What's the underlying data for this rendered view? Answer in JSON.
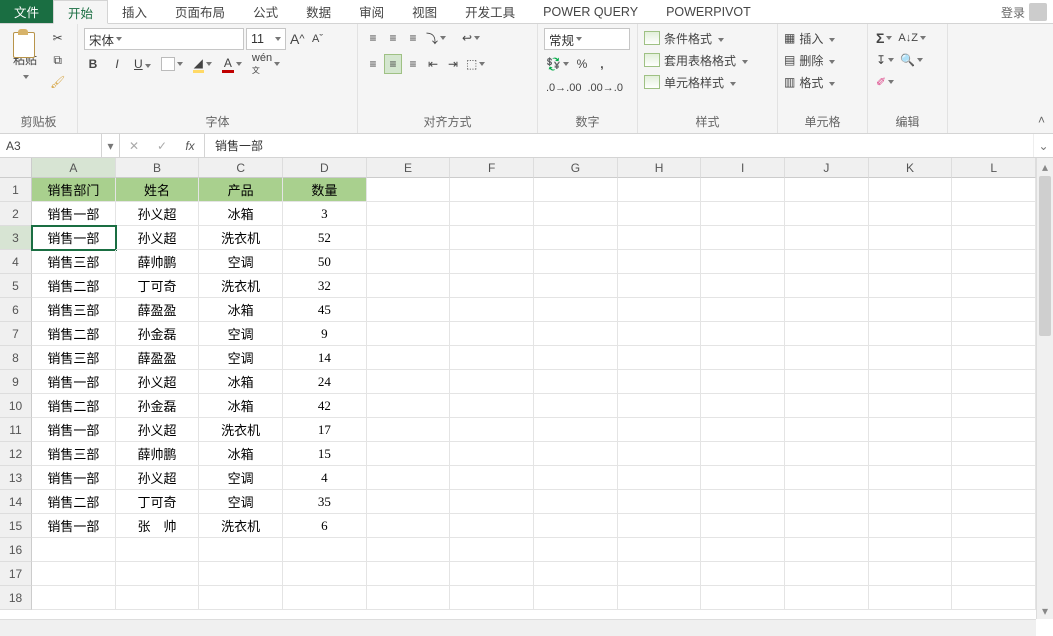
{
  "tabs": {
    "file": "文件",
    "items": [
      "开始",
      "插入",
      "页面布局",
      "公式",
      "数据",
      "审阅",
      "视图",
      "开发工具",
      "POWER QUERY",
      "POWERPIVOT"
    ],
    "active_index": 0,
    "signin": "登录"
  },
  "ribbon": {
    "clipboard": {
      "paste": "粘贴",
      "label": "剪贴板"
    },
    "font": {
      "name": "宋体",
      "size": "11",
      "label": "字体"
    },
    "alignment": {
      "label": "对齐方式"
    },
    "number": {
      "format": "常规",
      "label": "数字"
    },
    "styles": {
      "cond": "条件格式",
      "table": "套用表格格式",
      "cell": "单元格样式",
      "label": "样式"
    },
    "cells": {
      "insert": "插入",
      "delete": "删除",
      "format": "格式",
      "label": "单元格"
    },
    "editing": {
      "label": "编辑"
    }
  },
  "formula_bar": {
    "name_box": "A3",
    "formula": "销售一部"
  },
  "sheet": {
    "col_letters": [
      "A",
      "B",
      "C",
      "D",
      "E",
      "F",
      "G",
      "H",
      "I",
      "J",
      "K",
      "L"
    ],
    "row_count": 18,
    "selected_cell": "A3",
    "header": [
      "销售部门",
      "姓名",
      "产品",
      "数量"
    ],
    "rows": [
      [
        "销售一部",
        "孙义超",
        "冰箱",
        "3"
      ],
      [
        "销售一部",
        "孙义超",
        "洗衣机",
        "52"
      ],
      [
        "销售三部",
        "薛帅鹏",
        "空调",
        "50"
      ],
      [
        "销售二部",
        "丁可奇",
        "洗衣机",
        "32"
      ],
      [
        "销售三部",
        "薛盈盈",
        "冰箱",
        "45"
      ],
      [
        "销售二部",
        "孙金磊",
        "空调",
        "9"
      ],
      [
        "销售三部",
        "薛盈盈",
        "空调",
        "14"
      ],
      [
        "销售一部",
        "孙义超",
        "冰箱",
        "24"
      ],
      [
        "销售二部",
        "孙金磊",
        "冰箱",
        "42"
      ],
      [
        "销售一部",
        "孙义超",
        "洗衣机",
        "17"
      ],
      [
        "销售三部",
        "薛帅鹏",
        "冰箱",
        "15"
      ],
      [
        "销售一部",
        "孙义超",
        "空调",
        "4"
      ],
      [
        "销售二部",
        "丁可奇",
        "空调",
        "35"
      ],
      [
        "销售一部",
        "张　帅",
        "洗衣机",
        "6"
      ]
    ]
  }
}
